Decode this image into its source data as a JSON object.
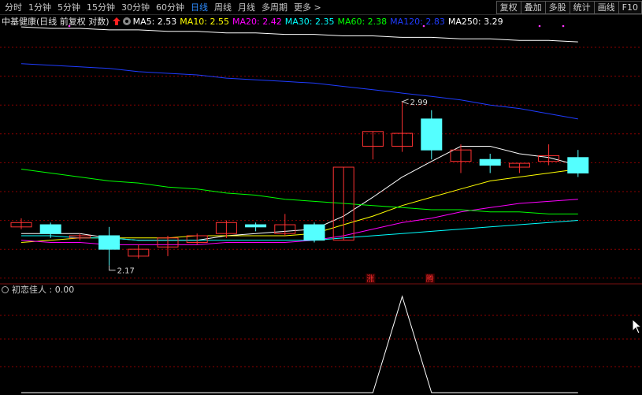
{
  "tabs": [
    {
      "label": "分时",
      "active": false
    },
    {
      "label": "1分钟",
      "active": false
    },
    {
      "label": "5分钟",
      "active": false
    },
    {
      "label": "15分钟",
      "active": false
    },
    {
      "label": "30分钟",
      "active": false
    },
    {
      "label": "60分钟",
      "active": false
    },
    {
      "label": "日线",
      "active": true
    },
    {
      "label": "周线",
      "active": false
    },
    {
      "label": "月线",
      "active": false
    },
    {
      "label": "多周期",
      "active": false
    },
    {
      "label": "更多 >",
      "active": false
    }
  ],
  "right_buttons": [
    "复权",
    "叠加",
    "多股",
    "统计",
    "画线",
    "F10"
  ],
  "info": {
    "stock_name": "中基健康(日线 前复权 对数)",
    "ma": [
      {
        "label": "MA5: 2.53",
        "color": "#ffffff"
      },
      {
        "label": "MA10: 2.55",
        "color": "#ffff00"
      },
      {
        "label": "MA20: 2.42",
        "color": "#ff00ff"
      },
      {
        "label": "MA30: 2.35",
        "color": "#00ffff"
      },
      {
        "label": "MA60: 2.38",
        "color": "#00ff00"
      },
      {
        "label": "MA120: 2.83",
        "color": "#1f3cff"
      },
      {
        "label": "MA250: 3.29",
        "color": "#ffffff"
      }
    ]
  },
  "sub": {
    "label": "初恋佳人 : 0.00"
  },
  "annotations": {
    "high": "2.99",
    "low": "2.17",
    "tag1": "涨",
    "tag2": "腾"
  },
  "colors": {
    "up": "#ff3232",
    "down": "#54ffff",
    "grid": "#8b0000",
    "bg": "#000000"
  },
  "chart_data": {
    "type": "candlestick",
    "scale": "log",
    "ylim": [
      2.1,
      3.45
    ],
    "candles": [
      {
        "o": 2.34,
        "c": 2.36,
        "h": 2.38,
        "l": 2.33
      },
      {
        "o": 2.35,
        "c": 2.31,
        "h": 2.36,
        "l": 2.29
      },
      {
        "o": 2.29,
        "c": 2.3,
        "h": 2.31,
        "l": 2.28
      },
      {
        "o": 2.3,
        "c": 2.24,
        "h": 2.34,
        "l": 2.17
      },
      {
        "o": 2.21,
        "c": 2.24,
        "h": 2.26,
        "l": 2.2
      },
      {
        "o": 2.25,
        "c": 2.29,
        "h": 2.3,
        "l": 2.21
      },
      {
        "o": 2.27,
        "c": 2.3,
        "h": 2.31,
        "l": 2.26
      },
      {
        "o": 2.31,
        "c": 2.36,
        "h": 2.37,
        "l": 2.29
      },
      {
        "o": 2.35,
        "c": 2.34,
        "h": 2.36,
        "l": 2.32
      },
      {
        "o": 2.31,
        "c": 2.35,
        "h": 2.4,
        "l": 2.3
      },
      {
        "o": 2.35,
        "c": 2.28,
        "h": 2.36,
        "l": 2.27
      },
      {
        "o": 2.28,
        "c": 2.63,
        "h": 2.63,
        "l": 2.28
      },
      {
        "o": 2.74,
        "c": 2.82,
        "h": 2.82,
        "l": 2.67
      },
      {
        "o": 2.74,
        "c": 2.81,
        "h": 2.99,
        "l": 2.71
      },
      {
        "o": 2.89,
        "c": 2.72,
        "h": 2.94,
        "l": 2.67
      },
      {
        "o": 2.66,
        "c": 2.72,
        "h": 2.75,
        "l": 2.6
      },
      {
        "o": 2.67,
        "c": 2.64,
        "h": 2.7,
        "l": 2.6
      },
      {
        "o": 2.63,
        "c": 2.65,
        "h": 2.65,
        "l": 2.6
      },
      {
        "o": 2.66,
        "c": 2.69,
        "h": 2.75,
        "l": 2.64
      },
      {
        "o": 2.68,
        "c": 2.6,
        "h": 2.72,
        "l": 2.58
      }
    ],
    "ma_series": [
      {
        "name": "MA5",
        "color": "#ffffff",
        "values": [
          2.31,
          2.31,
          2.31,
          2.29,
          2.28,
          2.28,
          2.28,
          2.3,
          2.31,
          2.32,
          2.33,
          2.39,
          2.48,
          2.58,
          2.66,
          2.74,
          2.74,
          2.7,
          2.68,
          2.64
        ]
      },
      {
        "name": "MA10",
        "color": "#ffff00",
        "values": [
          2.27,
          2.28,
          2.29,
          2.29,
          2.29,
          2.29,
          2.3,
          2.3,
          2.3,
          2.3,
          2.31,
          2.35,
          2.39,
          2.44,
          2.48,
          2.52,
          2.56,
          2.58,
          2.6,
          2.62
        ]
      },
      {
        "name": "MA20",
        "color": "#ff00ff",
        "values": [
          2.28,
          2.27,
          2.27,
          2.26,
          2.26,
          2.26,
          2.26,
          2.27,
          2.27,
          2.27,
          2.28,
          2.3,
          2.33,
          2.36,
          2.38,
          2.41,
          2.43,
          2.45,
          2.46,
          2.47
        ]
      },
      {
        "name": "MA30",
        "color": "#00ffff",
        "values": [
          2.3,
          2.3,
          2.29,
          2.29,
          2.28,
          2.28,
          2.28,
          2.28,
          2.28,
          2.28,
          2.28,
          2.29,
          2.3,
          2.31,
          2.32,
          2.33,
          2.34,
          2.35,
          2.36,
          2.37
        ]
      },
      {
        "name": "MA60",
        "color": "#00ff00",
        "values": [
          2.62,
          2.6,
          2.58,
          2.56,
          2.55,
          2.53,
          2.52,
          2.5,
          2.49,
          2.47,
          2.46,
          2.45,
          2.44,
          2.43,
          2.42,
          2.42,
          2.41,
          2.41,
          2.4,
          2.4
        ]
      },
      {
        "name": "MA120",
        "color": "#1f3cff",
        "values": [
          3.22,
          3.21,
          3.2,
          3.19,
          3.17,
          3.16,
          3.15,
          3.13,
          3.12,
          3.11,
          3.1,
          3.08,
          3.06,
          3.04,
          3.02,
          3.0,
          2.97,
          2.95,
          2.92,
          2.89
        ]
      },
      {
        "name": "MA250",
        "color": "#ffffff",
        "values": [
          3.46,
          3.45,
          3.45,
          3.44,
          3.44,
          3.43,
          3.43,
          3.42,
          3.42,
          3.41,
          3.41,
          3.4,
          3.4,
          3.39,
          3.39,
          3.38,
          3.38,
          3.37,
          3.37,
          3.36
        ]
      }
    ],
    "indicator": {
      "name": "初恋佳人",
      "values": [
        0,
        0,
        0,
        0,
        0,
        0,
        0,
        0,
        0,
        0,
        0,
        0,
        0,
        1,
        0,
        0,
        0,
        0,
        0,
        0
      ],
      "ylim": [
        0,
        1
      ]
    }
  }
}
